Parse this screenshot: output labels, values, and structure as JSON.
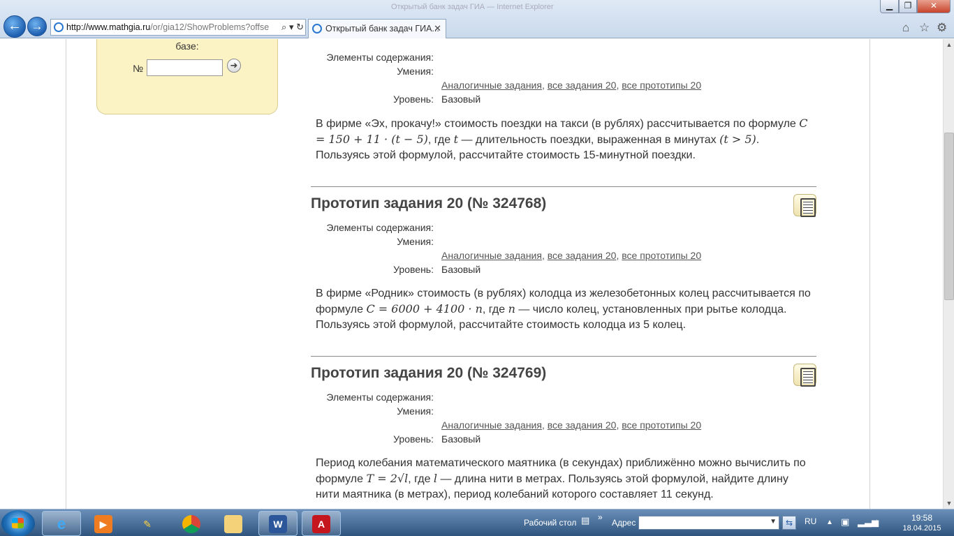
{
  "browser": {
    "url_host": "http://www.mathgia.ru",
    "url_rest": "/or/gia12/ShowProblems?offse",
    "tab_title": "Открытый банк задач ГИА...",
    "tab_close": "✕",
    "window_title": "Открытый банк задач ГИА — Internet Explorer"
  },
  "left_panel": {
    "text": "базе:",
    "number_label": "№",
    "go_symbol": "➜"
  },
  "meta_labels": {
    "elements": "Элементы содержания:",
    "skills": "Умения:",
    "level": "Уровень:"
  },
  "links": {
    "similar": "Аналогичные задания",
    "all_tasks": "все задания 20",
    "all_prototypes": "все прототипы 20",
    "sep": ","
  },
  "problems": [
    {
      "title": "",
      "level": "Базовый",
      "text_parts": [
        "В фирме «Эх, прокачу!» стоимость поездки на такси (в рублях) рассчитывается по формуле ",
        "C = 150 + 11 · (t − 5)",
        ", где ",
        "t",
        " — длительность поездки, выраженная в минутах ",
        "(t > 5)",
        ". Пользуясь этой формулой, рассчитайте стоимость 15-минутной поездки."
      ]
    },
    {
      "title": "Прототип задания 20 (№ 324768)",
      "level": "Базовый",
      "text_parts": [
        "В фирме «Родник» стоимость (в рублях) колодца из железобетонных колец рассчитывается по формуле ",
        "C = 6000 + 4100 · n",
        ", где ",
        "n",
        " — число колец, установленных при рытье колодца. Пользуясь этой формулой, рассчитайте стоимость колодца из 5 колец."
      ]
    },
    {
      "title": "Прототип задания 20 (№ 324769)",
      "level": "Базовый",
      "text_parts": [
        "Период колебания математического маятника (в секундах) приближённо можно вычислить по формуле ",
        "T = 2√l",
        ", где ",
        "l",
        " — длина нити в метрах. Пользуясь этой формулой, найдите длину нити маятника (в метрах), период колебаний которого составляет 11 секунд."
      ]
    }
  ],
  "taskbar": {
    "desktop_label": "Рабочий стол",
    "address_label": "Адрес",
    "lang": "RU",
    "time": "19:58",
    "date": "18.04.2015",
    "chevron": "»"
  },
  "icons": {
    "back": "arrow-left-icon",
    "forward": "arrow-right-icon",
    "home": "home-icon",
    "favorites": "star-icon",
    "tools": "gear-icon",
    "problem_doc": "document-icon"
  }
}
